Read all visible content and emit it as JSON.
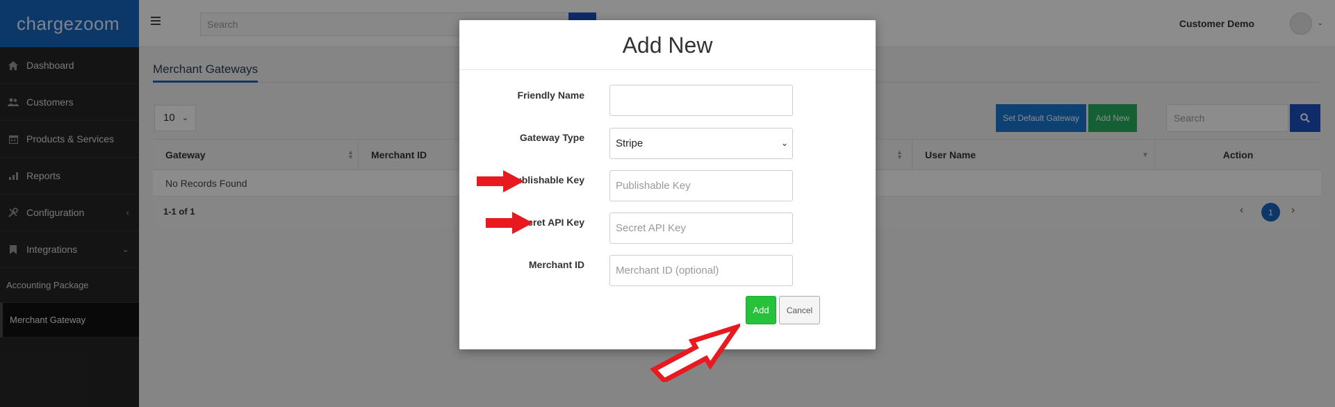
{
  "brand": {
    "logo_text": "chargezoom"
  },
  "topbar": {
    "search_placeholder": "Search",
    "user_name": "Customer Demo"
  },
  "sidebar": {
    "items": [
      {
        "label": "Dashboard",
        "icon": "home-icon"
      },
      {
        "label": "Customers",
        "icon": "users-icon"
      },
      {
        "label": "Products & Services",
        "icon": "calendar-icon"
      },
      {
        "label": "Reports",
        "icon": "bar-chart-icon"
      },
      {
        "label": "Configuration",
        "icon": "wrench-icon",
        "chevron": "‹"
      },
      {
        "label": "Integrations",
        "icon": "bookmark-icon",
        "chevron": "⌄"
      }
    ],
    "sub_items": [
      {
        "label": "Accounting Package",
        "active": false
      },
      {
        "label": "Merchant Gateway",
        "active": true
      }
    ]
  },
  "page": {
    "title": "Merchant Gateways",
    "per_page": "10",
    "buttons": {
      "set_default": "Set Default Gateway",
      "add_new": "Add New"
    },
    "list_search_placeholder": "Search",
    "table": {
      "columns": [
        "Gateway",
        "Merchant ID",
        "User Name",
        "Action"
      ],
      "empty_message": "No Records Found"
    },
    "pagination": {
      "range": "1-1 of 1",
      "current_page": "1"
    }
  },
  "modal": {
    "title": "Add New",
    "fields": {
      "friendly_name": {
        "label": "Friendly Name",
        "value": "",
        "placeholder": ""
      },
      "gateway_type": {
        "label": "Gateway Type",
        "value": "Stripe"
      },
      "publishable_key": {
        "label": "Publishable Key",
        "placeholder": "Publishable Key"
      },
      "secret_api_key": {
        "label": "Secret API Key",
        "placeholder": "Secret API Key"
      },
      "merchant_id": {
        "label": "Merchant ID",
        "placeholder": "Merchant ID (optional)"
      }
    },
    "buttons": {
      "add": "Add",
      "cancel": "Cancel"
    }
  },
  "colors": {
    "brand_blue": "#1565c0",
    "sidebar_bg": "#262626",
    "add_green": "#27c23b",
    "annotation_red": "#e8191f"
  }
}
